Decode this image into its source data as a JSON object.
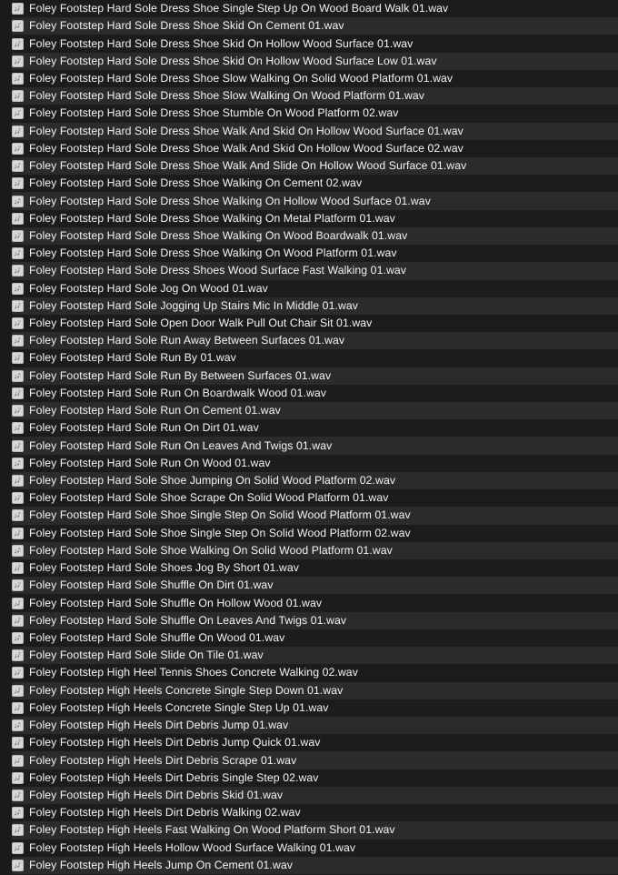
{
  "window": {
    "title": "Sound Effects Library File List",
    "view_mode": "list",
    "background_color": "#1a1a1a",
    "row_color_odd": "#1c1c1c",
    "row_color_even": "#2b2b2b",
    "text_color": "#f2f2f2"
  },
  "file_list": {
    "icon_name": "audio-file-icon",
    "item_count": 50,
    "items": [
      {
        "name": "Foley Footstep Hard Sole Dress Shoe Single Step Up On Wood Board Walk 01.wav"
      },
      {
        "name": "Foley Footstep Hard Sole Dress Shoe Skid On Cement 01.wav"
      },
      {
        "name": "Foley Footstep Hard Sole Dress Shoe Skid On Hollow Wood Surface 01.wav"
      },
      {
        "name": "Foley Footstep Hard Sole Dress Shoe Skid On Hollow Wood Surface Low 01.wav"
      },
      {
        "name": "Foley Footstep Hard Sole Dress Shoe Slow Walking On Solid Wood Platform 01.wav"
      },
      {
        "name": "Foley Footstep Hard Sole Dress Shoe Slow Walking On Wood Platform 01.wav"
      },
      {
        "name": "Foley Footstep Hard Sole Dress Shoe Stumble On Wood Platform 02.wav"
      },
      {
        "name": "Foley Footstep Hard Sole Dress Shoe Walk And Skid On Hollow Wood Surface 01.wav"
      },
      {
        "name": "Foley Footstep Hard Sole Dress Shoe Walk And Skid On Hollow Wood Surface 02.wav"
      },
      {
        "name": "Foley Footstep Hard Sole Dress Shoe Walk And Slide On Hollow Wood Surface 01.wav"
      },
      {
        "name": "Foley Footstep Hard Sole Dress Shoe Walking On Cement 02.wav"
      },
      {
        "name": "Foley Footstep Hard Sole Dress Shoe Walking On Hollow Wood Surface 01.wav"
      },
      {
        "name": "Foley Footstep Hard Sole Dress Shoe Walking On Metal Platform 01.wav"
      },
      {
        "name": "Foley Footstep Hard Sole Dress Shoe Walking On Wood Boardwalk 01.wav"
      },
      {
        "name": "Foley Footstep Hard Sole Dress Shoe Walking On Wood Platform 01.wav"
      },
      {
        "name": "Foley Footstep Hard Sole Dress Shoes Wood Surface Fast Walking 01.wav"
      },
      {
        "name": "Foley Footstep Hard Sole Jog On Wood 01.wav"
      },
      {
        "name": "Foley Footstep Hard Sole Jogging Up Stairs Mic In Middle 01.wav"
      },
      {
        "name": "Foley Footstep Hard Sole Open Door Walk Pull Out Chair Sit 01.wav"
      },
      {
        "name": "Foley Footstep Hard Sole Run Away Between Surfaces 01.wav"
      },
      {
        "name": "Foley Footstep Hard Sole Run By 01.wav"
      },
      {
        "name": "Foley Footstep Hard Sole Run By Between Surfaces 01.wav"
      },
      {
        "name": "Foley Footstep Hard Sole Run On Boardwalk Wood 01.wav"
      },
      {
        "name": "Foley Footstep Hard Sole Run On Cement 01.wav"
      },
      {
        "name": "Foley Footstep Hard Sole Run On Dirt 01.wav"
      },
      {
        "name": "Foley Footstep Hard Sole Run On Leaves And Twigs 01.wav"
      },
      {
        "name": "Foley Footstep Hard Sole Run On Wood 01.wav"
      },
      {
        "name": "Foley Footstep Hard Sole Shoe Jumping On Solid Wood Platform 02.wav"
      },
      {
        "name": "Foley Footstep Hard Sole Shoe Scrape On Solid Wood Platform 01.wav"
      },
      {
        "name": "Foley Footstep Hard Sole Shoe Single Step On Solid Wood Platform 01.wav"
      },
      {
        "name": "Foley Footstep Hard Sole Shoe Single Step On Solid Wood Platform 02.wav"
      },
      {
        "name": "Foley Footstep Hard Sole Shoe Walking On Solid Wood Platform 01.wav"
      },
      {
        "name": "Foley Footstep Hard Sole Shoes Jog By Short 01.wav"
      },
      {
        "name": "Foley Footstep Hard Sole Shuffle On Dirt 01.wav"
      },
      {
        "name": "Foley Footstep Hard Sole Shuffle On Hollow Wood 01.wav"
      },
      {
        "name": "Foley Footstep Hard Sole Shuffle On Leaves And Twigs 01.wav"
      },
      {
        "name": "Foley Footstep Hard Sole Shuffle On Wood 01.wav"
      },
      {
        "name": "Foley Footstep Hard Sole Slide On Tile 01.wav"
      },
      {
        "name": "Foley Footstep High Heel Tennis Shoes Concrete Walking 02.wav"
      },
      {
        "name": "Foley Footstep High Heels Concrete Single Step Down 01.wav"
      },
      {
        "name": "Foley Footstep High Heels Concrete Single Step Up 01.wav"
      },
      {
        "name": "Foley Footstep High Heels Dirt Debris Jump 01.wav"
      },
      {
        "name": "Foley Footstep High Heels Dirt Debris Jump Quick 01.wav"
      },
      {
        "name": "Foley Footstep High Heels Dirt Debris Scrape 01.wav"
      },
      {
        "name": "Foley Footstep High Heels Dirt Debris Single Step 02.wav"
      },
      {
        "name": "Foley Footstep High Heels Dirt Debris Skid 01.wav"
      },
      {
        "name": "Foley Footstep High Heels Dirt Debris Walking 02.wav"
      },
      {
        "name": "Foley Footstep High Heels Fast Walking On Wood Platform Short 01.wav"
      },
      {
        "name": "Foley Footstep High Heels Hollow Wood Surface Walking 01.wav"
      },
      {
        "name": "Foley Footstep High Heels Jump On Cement 01.wav"
      }
    ]
  }
}
